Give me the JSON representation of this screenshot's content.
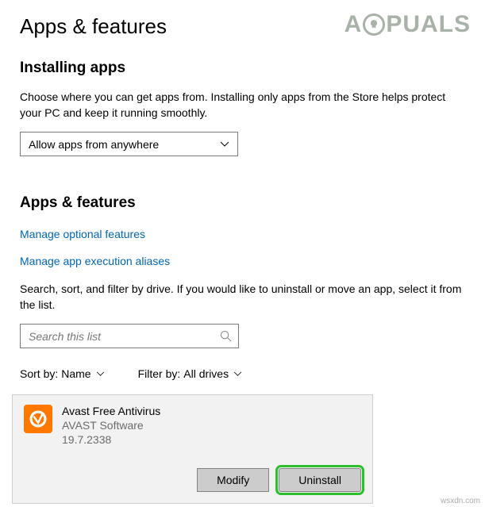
{
  "watermark": {
    "pre": "A",
    "post": "PUALS"
  },
  "page_title": "Apps & features",
  "installing": {
    "heading": "Installing apps",
    "desc": "Choose where you can get apps from. Installing only apps from the Store helps protect your PC and keep it running smoothly.",
    "dropdown_value": "Allow apps from anywhere"
  },
  "apps": {
    "heading": "Apps & features",
    "link_optional": "Manage optional features",
    "link_aliases": "Manage app execution aliases",
    "desc": "Search, sort, and filter by drive. If you would like to uninstall or move an app, select it from the list.",
    "search_placeholder": "Search this list"
  },
  "filters": {
    "sort_label": "Sort by:",
    "sort_value": "Name",
    "filter_label": "Filter by:",
    "filter_value": "All drives"
  },
  "app_item": {
    "name": "Avast Free Antivirus",
    "publisher": "AVAST Software",
    "version": "19.7.2338",
    "modify_label": "Modify",
    "uninstall_label": "Uninstall"
  },
  "attribution": "wsxdn.com"
}
